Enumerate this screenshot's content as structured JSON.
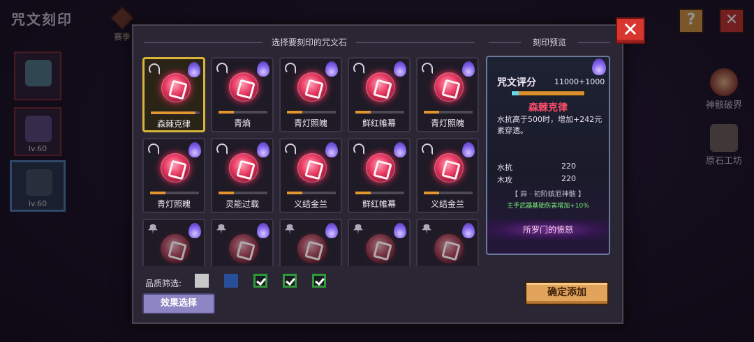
{
  "page": {
    "title": "咒文刻印",
    "season_label": "赛季",
    "characters": [
      {
        "level": ""
      },
      {
        "level": "lv.60"
      },
      {
        "level": "lv.60"
      }
    ],
    "help_icon": "?",
    "close_icon": "✕",
    "side_items": [
      {
        "label": "神骸破界",
        "icon": "shrine-icon"
      },
      {
        "label": "原石工坊",
        "icon": "workshop-icon"
      }
    ]
  },
  "modal": {
    "close_label": "✕",
    "left_header": "选择要刻印的咒文石",
    "right_header": "刻印预览",
    "runes": [
      {
        "name": "森棘克律",
        "progress": 0.92,
        "locked": false,
        "selected": true
      },
      {
        "name": "青熵",
        "progress": 0.32,
        "locked": false,
        "selected": false
      },
      {
        "name": "青灯照魄",
        "progress": 0.32,
        "locked": false,
        "selected": false
      },
      {
        "name": "鲜红帷幕",
        "progress": 0.32,
        "locked": false,
        "selected": false
      },
      {
        "name": "青灯照魄",
        "progress": 0.32,
        "locked": false,
        "selected": false
      },
      {
        "name": "青灯照魄",
        "progress": 0.32,
        "locked": false,
        "selected": false
      },
      {
        "name": "灵能过载",
        "progress": 0.32,
        "locked": false,
        "selected": false
      },
      {
        "name": "义结金兰",
        "progress": 0.32,
        "locked": false,
        "selected": false
      },
      {
        "name": "鲜红帷幕",
        "progress": 0.32,
        "locked": false,
        "selected": false
      },
      {
        "name": "义结金兰",
        "progress": 0.32,
        "locked": false,
        "selected": false
      },
      {
        "name": "",
        "progress": 0,
        "locked": true,
        "selected": false
      },
      {
        "name": "",
        "progress": 0,
        "locked": true,
        "selected": false
      },
      {
        "name": "",
        "progress": 0,
        "locked": true,
        "selected": false
      },
      {
        "name": "",
        "progress": 0,
        "locked": true,
        "selected": false
      },
      {
        "name": "",
        "progress": 0,
        "locked": true,
        "selected": false
      }
    ],
    "preview": {
      "score_label": "咒文评分",
      "score_value": "11000+1000",
      "rune_name": "森棘克律",
      "description": "水抗高于500时，增加+242元素穿透。",
      "stats": [
        {
          "label": "水抗",
          "value": "220"
        },
        {
          "label": "木攻",
          "value": "220"
        }
      ],
      "set_name": "【 异 · 初阶嫔厄神骸 】",
      "set_effect": "主手武器基础伤害增加+10%",
      "tag": "所罗门的愤怒"
    },
    "filter_label": "品质筛选:",
    "quality_filters": [
      {
        "color": "#c8c8c8",
        "checked": false
      },
      {
        "color": "#2a4f9a",
        "checked": false
      },
      {
        "color": "#2f9a3a",
        "checked": true
      },
      {
        "color": "#2f9a3a",
        "checked": true
      },
      {
        "color": "#2f9a3a",
        "checked": true
      }
    ],
    "effect_button": "效果选择",
    "confirm_button": "确定添加"
  }
}
